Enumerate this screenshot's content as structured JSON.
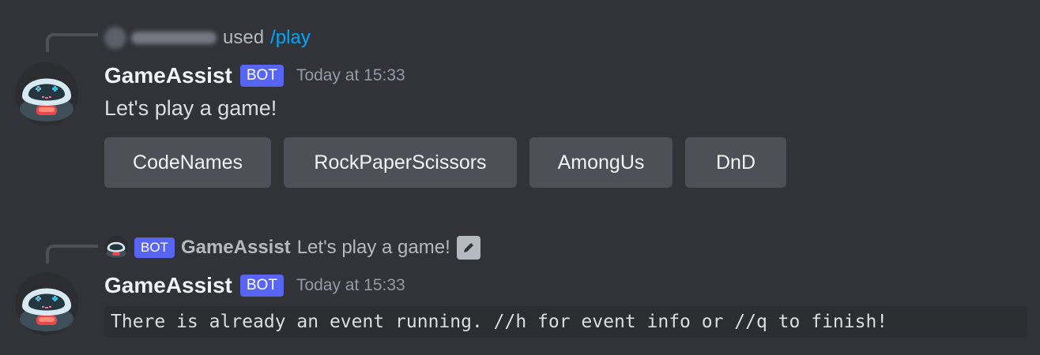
{
  "messages": [
    {
      "reply": {
        "action_text": "used",
        "command": "/play"
      },
      "author": "GameAssist",
      "bot_tag": "BOT",
      "timestamp": "Today at 15:33",
      "text": "Let's play a game!",
      "buttons": [
        "CodeNames",
        "RockPaperScissors",
        "AmongUs",
        "DnD"
      ]
    },
    {
      "reply": {
        "bot_tag": "BOT",
        "author": "GameAssist",
        "text": "Let's play a game!"
      },
      "author": "GameAssist",
      "bot_tag": "BOT",
      "timestamp": "Today at 15:33",
      "code_text": "There is already an event running. //h for event info or //q to finish!"
    }
  ],
  "colors": {
    "background": "#313338",
    "bot_tag": "#5865f2",
    "command_link": "#00a8fc",
    "button": "#4e5058"
  },
  "icons": {
    "avatar": "robot-avatar-icon",
    "edit": "pencil-icon"
  }
}
